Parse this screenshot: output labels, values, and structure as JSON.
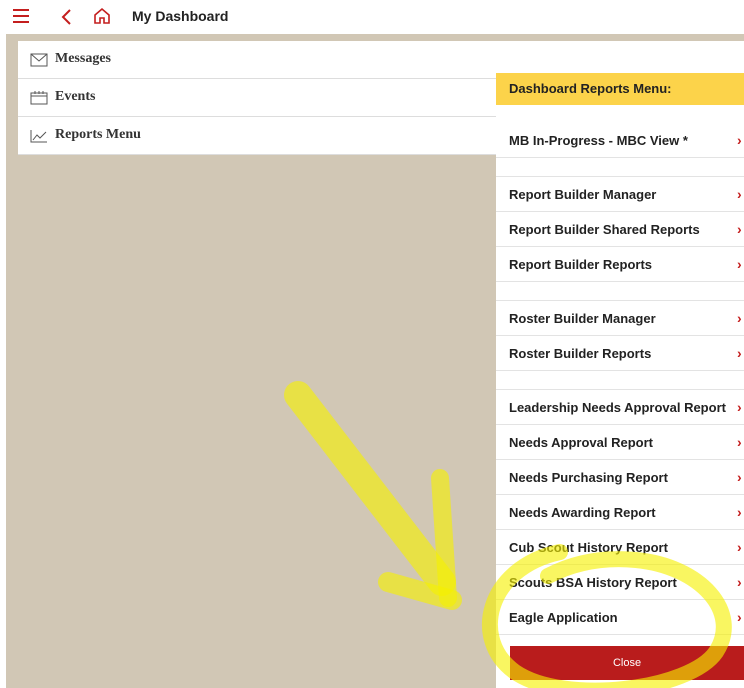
{
  "header": {
    "title": "My Dashboard"
  },
  "left_menu": {
    "items": [
      {
        "label": "Messages",
        "icon": "envelope-icon"
      },
      {
        "label": "Events",
        "icon": "calendar-icon"
      },
      {
        "label": "Reports Menu",
        "icon": "line-chart-icon"
      }
    ]
  },
  "reports_menu": {
    "title": "Dashboard Reports Menu:",
    "groups": [
      [
        "MB In-Progress - MBC View *"
      ],
      [
        "Report Builder Manager",
        "Report Builder Shared Reports",
        "Report Builder Reports"
      ],
      [
        "Roster Builder Manager",
        "Roster Builder Reports"
      ],
      [
        "Leadership Needs Approval Report",
        "Needs Approval Report",
        "Needs Purchasing Report",
        "Needs Awarding Report",
        "Cub Scout History Report",
        "Scouts BSA History Report",
        "Eagle Application"
      ]
    ],
    "chevron": "›",
    "close_label": "Close"
  },
  "colors": {
    "accent": "#c41e1e",
    "menu_header": "#fcd34a",
    "background": "#d1c7b5",
    "highlight_annotation": "#f5f000"
  }
}
